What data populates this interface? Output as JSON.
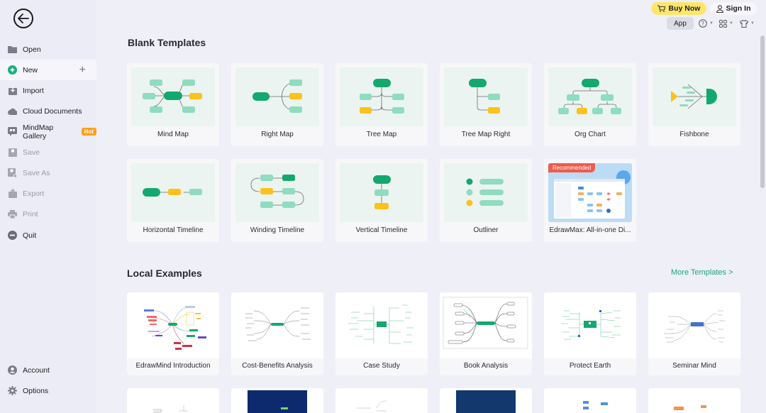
{
  "sidebar": {
    "back_label": "Back",
    "items": [
      {
        "label": "Open",
        "icon": "folder-icon",
        "state": "normal"
      },
      {
        "label": "New",
        "icon": "plus-circle-icon",
        "state": "active"
      },
      {
        "label": "Import",
        "icon": "import-icon",
        "state": "normal"
      },
      {
        "label": "Cloud Documents",
        "icon": "cloud-icon",
        "state": "normal"
      },
      {
        "label": "MindMap Gallery",
        "icon": "gallery-icon",
        "state": "normal",
        "badge": "Hot"
      },
      {
        "label": "Save",
        "icon": "save-icon",
        "state": "disabled"
      },
      {
        "label": "Save As",
        "icon": "save-as-icon",
        "state": "disabled"
      },
      {
        "label": "Export",
        "icon": "export-icon",
        "state": "disabled"
      },
      {
        "label": "Print",
        "icon": "print-icon",
        "state": "disabled"
      },
      {
        "label": "Quit",
        "icon": "quit-icon",
        "state": "normal"
      }
    ],
    "bottom_items": [
      {
        "label": "Account",
        "icon": "account-icon"
      },
      {
        "label": "Options",
        "icon": "gear-icon"
      }
    ]
  },
  "header": {
    "buy_now": "Buy Now",
    "sign_in": "Sign In",
    "app": "App",
    "icons": [
      "help-icon",
      "apps-grid-icon",
      "theme-shirt-icon"
    ]
  },
  "blank_templates": {
    "title": "Blank Templates",
    "items": [
      {
        "label": "Mind Map"
      },
      {
        "label": "Right Map"
      },
      {
        "label": "Tree Map"
      },
      {
        "label": "Tree Map Right"
      },
      {
        "label": "Org Chart"
      },
      {
        "label": "Fishbone"
      },
      {
        "label": "Horizontal Timeline"
      },
      {
        "label": "Winding Timeline"
      },
      {
        "label": "Vertical Timeline"
      },
      {
        "label": "Outliner"
      },
      {
        "label": "EdrawMax: All-in-one Di...",
        "badge": "Recommended"
      }
    ]
  },
  "local_examples": {
    "title": "Local Examples",
    "more_link": "More Templates >",
    "items": [
      {
        "label": "EdrawMind Introduction"
      },
      {
        "label": "Cost-Benefits Analysis"
      },
      {
        "label": "Case Study"
      },
      {
        "label": "Book Analysis"
      },
      {
        "label": "Protect Earth"
      },
      {
        "label": "Seminar Mind"
      }
    ]
  },
  "colors": {
    "accent_green": "#13a86f",
    "light_green": "#8fdcc0",
    "yellow": "#fcc21b",
    "buy_bg": "#ffe66b",
    "hot_badge": "#ff9f1c",
    "recommended_badge": "#ef5b4c",
    "link": "#17a877"
  }
}
